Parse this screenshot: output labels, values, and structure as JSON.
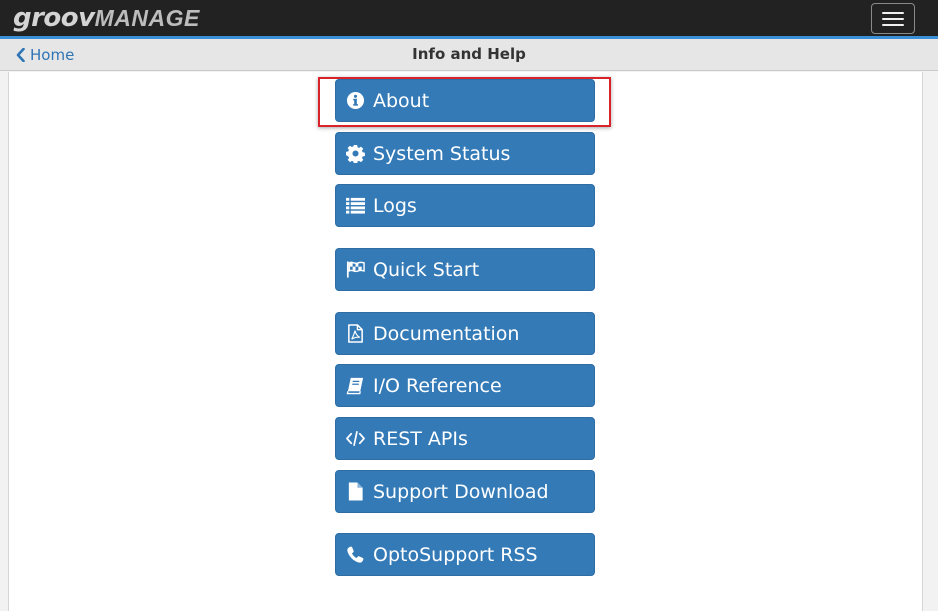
{
  "app": {
    "logo_part1": "groov",
    "logo_part2": "MANAGE"
  },
  "nav": {
    "back_label": "Home",
    "title": "Info and Help"
  },
  "menu": [
    {
      "label": "About",
      "icon": "info-circle-icon"
    },
    {
      "label": "System Status",
      "icon": "gear-icon"
    },
    {
      "label": "Logs",
      "icon": "list-icon"
    },
    {
      "label": "Quick Start",
      "icon": "checkered-flag-icon"
    },
    {
      "label": "Documentation",
      "icon": "pdf-file-icon"
    },
    {
      "label": "I/O Reference",
      "icon": "book-icon"
    },
    {
      "label": "REST APIs",
      "icon": "code-icon"
    },
    {
      "label": "Support Download",
      "icon": "file-icon"
    },
    {
      "label": "OptoSupport RSS",
      "icon": "phone-icon"
    }
  ],
  "colors": {
    "accent": "#337ab7",
    "topbar": "#222222",
    "highlight": "#d9232a"
  }
}
